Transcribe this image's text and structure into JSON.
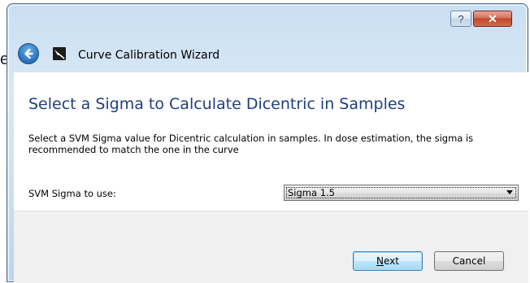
{
  "background": {
    "fragment_text": "e"
  },
  "window": {
    "title": "Curve Calibration Wizard",
    "help_label": "?",
    "close_label": "✕"
  },
  "page": {
    "heading": "Select a Sigma to Calculate Dicentric in Samples",
    "description": "Select a SVM Sigma value for Dicentric calculation in samples. In dose estimation, the sigma is recommended to match the one in the curve",
    "sigma_label": "SVM Sigma to use:",
    "sigma_value": "Sigma 1.5"
  },
  "footer": {
    "next_prefix": "N",
    "next_rest": "ext",
    "cancel_label": "Cancel"
  },
  "colors": {
    "heading": "#1e3f82",
    "close_button": "#c0462a",
    "next_button_border": "#3c7fb1"
  }
}
